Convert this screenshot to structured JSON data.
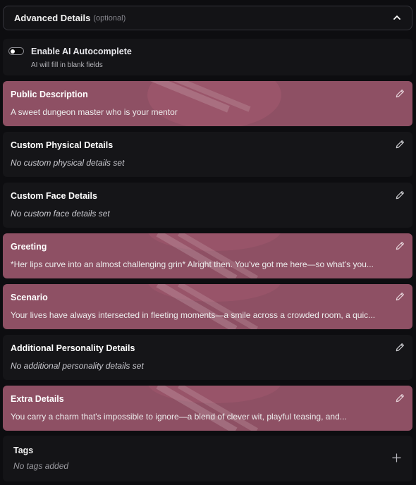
{
  "header": {
    "title": "Advanced Details",
    "optional": "(optional)"
  },
  "autocomplete": {
    "label": "Enable AI Autocomplete",
    "subtext": "AI will fill in blank fields",
    "enabled": false
  },
  "cards": [
    {
      "title": "Public Description",
      "text": "A sweet dungeon master who is your mentor",
      "filled": true
    },
    {
      "title": "Custom Physical Details",
      "text": "No custom physical details set",
      "filled": false
    },
    {
      "title": "Custom Face Details",
      "text": "No custom face details set",
      "filled": false
    },
    {
      "title": "Greeting",
      "text": "*Her lips curve into an almost challenging grin* Alright then. You've got me here—so what's you...",
      "filled": true
    },
    {
      "title": "Scenario",
      "text": "Your lives have always intersected in fleeting moments—a smile across a crowded room, a quic...",
      "filled": true
    },
    {
      "title": "Additional Personality Details",
      "text": "No additional personality details set",
      "filled": false
    },
    {
      "title": "Extra Details",
      "text": "You carry a charm that's impossible to ignore—a blend of clever wit, playful teasing, and...",
      "filled": true
    }
  ],
  "tags": {
    "title": "Tags",
    "empty": "No tags added"
  },
  "colors": {
    "highlight": "#8e5064",
    "card": "#151518",
    "background": "#0d0d10"
  }
}
